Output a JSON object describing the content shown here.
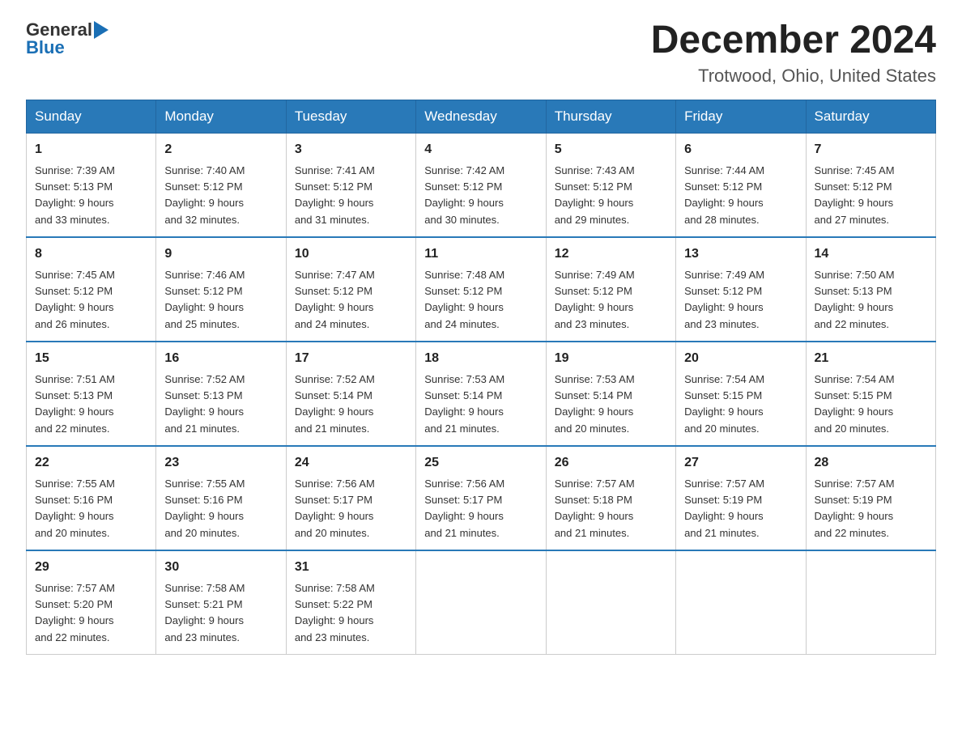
{
  "logo": {
    "text_general": "General",
    "text_blue": "Blue",
    "arrow": "▶"
  },
  "title": "December 2024",
  "subtitle": "Trotwood, Ohio, United States",
  "weekdays": [
    "Sunday",
    "Monday",
    "Tuesday",
    "Wednesday",
    "Thursday",
    "Friday",
    "Saturday"
  ],
  "weeks": [
    [
      {
        "day": "1",
        "sunrise": "7:39 AM",
        "sunset": "5:13 PM",
        "daylight": "9 hours and 33 minutes."
      },
      {
        "day": "2",
        "sunrise": "7:40 AM",
        "sunset": "5:12 PM",
        "daylight": "9 hours and 32 minutes."
      },
      {
        "day": "3",
        "sunrise": "7:41 AM",
        "sunset": "5:12 PM",
        "daylight": "9 hours and 31 minutes."
      },
      {
        "day": "4",
        "sunrise": "7:42 AM",
        "sunset": "5:12 PM",
        "daylight": "9 hours and 30 minutes."
      },
      {
        "day": "5",
        "sunrise": "7:43 AM",
        "sunset": "5:12 PM",
        "daylight": "9 hours and 29 minutes."
      },
      {
        "day": "6",
        "sunrise": "7:44 AM",
        "sunset": "5:12 PM",
        "daylight": "9 hours and 28 minutes."
      },
      {
        "day": "7",
        "sunrise": "7:45 AM",
        "sunset": "5:12 PM",
        "daylight": "9 hours and 27 minutes."
      }
    ],
    [
      {
        "day": "8",
        "sunrise": "7:45 AM",
        "sunset": "5:12 PM",
        "daylight": "9 hours and 26 minutes."
      },
      {
        "day": "9",
        "sunrise": "7:46 AM",
        "sunset": "5:12 PM",
        "daylight": "9 hours and 25 minutes."
      },
      {
        "day": "10",
        "sunrise": "7:47 AM",
        "sunset": "5:12 PM",
        "daylight": "9 hours and 24 minutes."
      },
      {
        "day": "11",
        "sunrise": "7:48 AM",
        "sunset": "5:12 PM",
        "daylight": "9 hours and 24 minutes."
      },
      {
        "day": "12",
        "sunrise": "7:49 AM",
        "sunset": "5:12 PM",
        "daylight": "9 hours and 23 minutes."
      },
      {
        "day": "13",
        "sunrise": "7:49 AM",
        "sunset": "5:12 PM",
        "daylight": "9 hours and 23 minutes."
      },
      {
        "day": "14",
        "sunrise": "7:50 AM",
        "sunset": "5:13 PM",
        "daylight": "9 hours and 22 minutes."
      }
    ],
    [
      {
        "day": "15",
        "sunrise": "7:51 AM",
        "sunset": "5:13 PM",
        "daylight": "9 hours and 22 minutes."
      },
      {
        "day": "16",
        "sunrise": "7:52 AM",
        "sunset": "5:13 PM",
        "daylight": "9 hours and 21 minutes."
      },
      {
        "day": "17",
        "sunrise": "7:52 AM",
        "sunset": "5:14 PM",
        "daylight": "9 hours and 21 minutes."
      },
      {
        "day": "18",
        "sunrise": "7:53 AM",
        "sunset": "5:14 PM",
        "daylight": "9 hours and 21 minutes."
      },
      {
        "day": "19",
        "sunrise": "7:53 AM",
        "sunset": "5:14 PM",
        "daylight": "9 hours and 20 minutes."
      },
      {
        "day": "20",
        "sunrise": "7:54 AM",
        "sunset": "5:15 PM",
        "daylight": "9 hours and 20 minutes."
      },
      {
        "day": "21",
        "sunrise": "7:54 AM",
        "sunset": "5:15 PM",
        "daylight": "9 hours and 20 minutes."
      }
    ],
    [
      {
        "day": "22",
        "sunrise": "7:55 AM",
        "sunset": "5:16 PM",
        "daylight": "9 hours and 20 minutes."
      },
      {
        "day": "23",
        "sunrise": "7:55 AM",
        "sunset": "5:16 PM",
        "daylight": "9 hours and 20 minutes."
      },
      {
        "day": "24",
        "sunrise": "7:56 AM",
        "sunset": "5:17 PM",
        "daylight": "9 hours and 20 minutes."
      },
      {
        "day": "25",
        "sunrise": "7:56 AM",
        "sunset": "5:17 PM",
        "daylight": "9 hours and 21 minutes."
      },
      {
        "day": "26",
        "sunrise": "7:57 AM",
        "sunset": "5:18 PM",
        "daylight": "9 hours and 21 minutes."
      },
      {
        "day": "27",
        "sunrise": "7:57 AM",
        "sunset": "5:19 PM",
        "daylight": "9 hours and 21 minutes."
      },
      {
        "day": "28",
        "sunrise": "7:57 AM",
        "sunset": "5:19 PM",
        "daylight": "9 hours and 22 minutes."
      }
    ],
    [
      {
        "day": "29",
        "sunrise": "7:57 AM",
        "sunset": "5:20 PM",
        "daylight": "9 hours and 22 minutes."
      },
      {
        "day": "30",
        "sunrise": "7:58 AM",
        "sunset": "5:21 PM",
        "daylight": "9 hours and 23 minutes."
      },
      {
        "day": "31",
        "sunrise": "7:58 AM",
        "sunset": "5:22 PM",
        "daylight": "9 hours and 23 minutes."
      },
      null,
      null,
      null,
      null
    ]
  ],
  "labels": {
    "sunrise_prefix": "Sunrise: ",
    "sunset_prefix": "Sunset: ",
    "daylight_prefix": "Daylight: "
  }
}
